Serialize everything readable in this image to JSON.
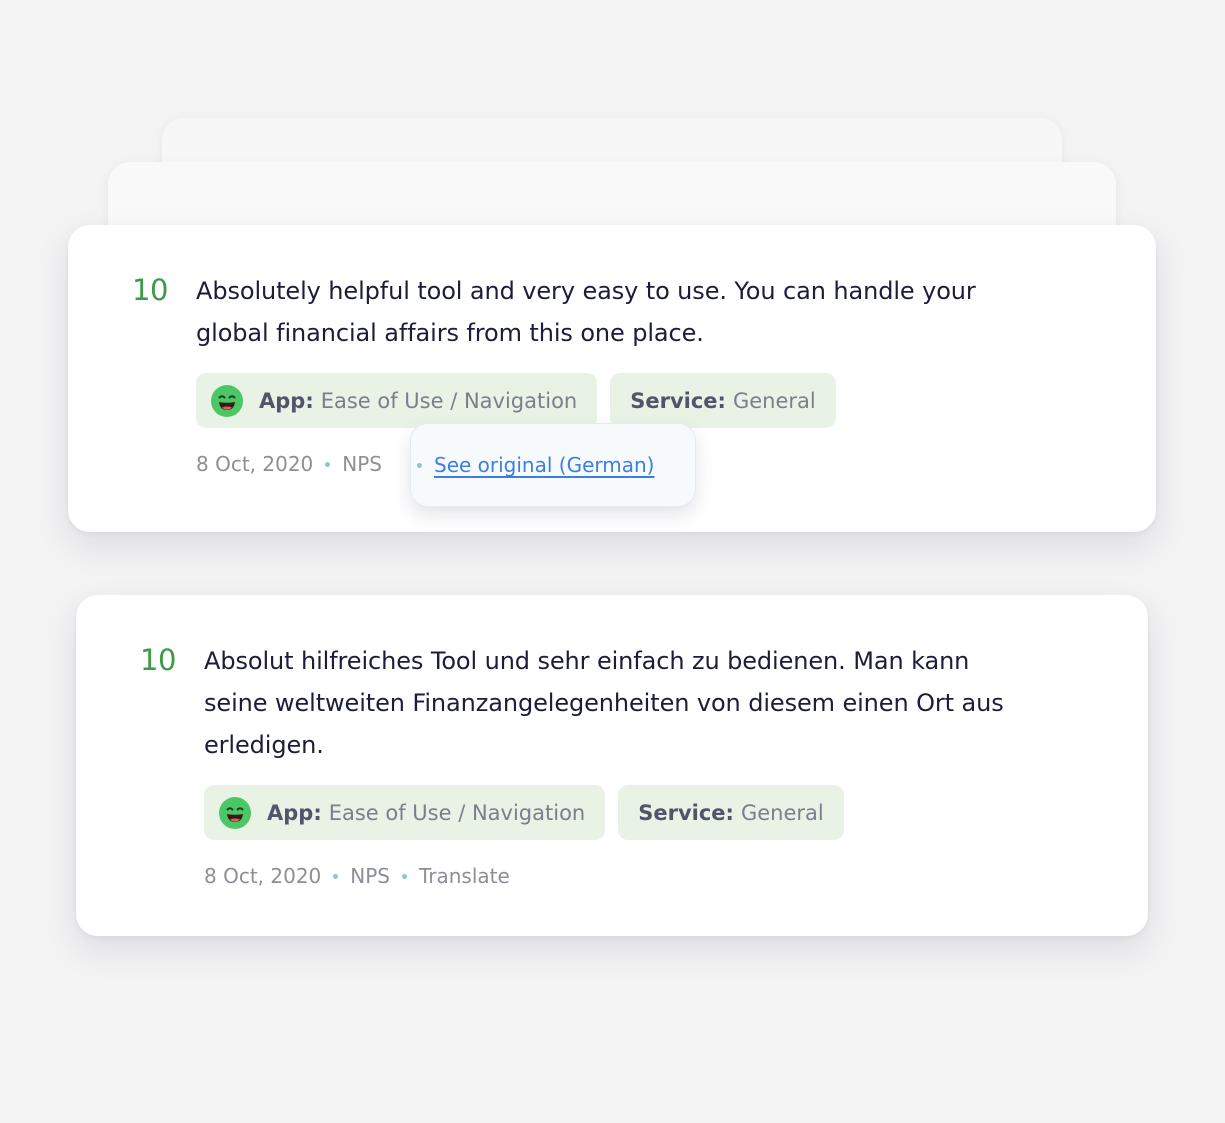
{
  "reviews": [
    {
      "score": "10",
      "text_line_1": "Absolutely helpful tool and very easy to use. You can handle your",
      "text_line_2": "global financial affairs from this one place.",
      "tags": [
        {
          "key": "App:",
          "value": "Ease of Use / Navigation",
          "icon": "laughing-face-icon"
        },
        {
          "key": "Service:",
          "value": "General"
        }
      ],
      "date": "8 Oct, 2020",
      "channel": "NPS",
      "action_link": "See original (German)"
    },
    {
      "score": "10",
      "text_line_1": "Absolut hilfreiches Tool und sehr einfach zu bedienen. Man kann",
      "text_line_2": "seine weltweiten Finanzangelegenheiten von diesem einen Ort aus",
      "text_line_3": "erledigen.",
      "tags": [
        {
          "key": "App:",
          "value": "Ease of Use / Navigation",
          "icon": "laughing-face-icon"
        },
        {
          "key": "Service:",
          "value": "General"
        }
      ],
      "date": "8 Oct, 2020",
      "channel": "NPS",
      "action_link": "Translate"
    }
  ],
  "colors": {
    "score_green": "#3f9a47",
    "tag_background": "#e8f3e6",
    "link_blue": "#3d7fe0",
    "dot_teal": "#8fc5cf"
  }
}
